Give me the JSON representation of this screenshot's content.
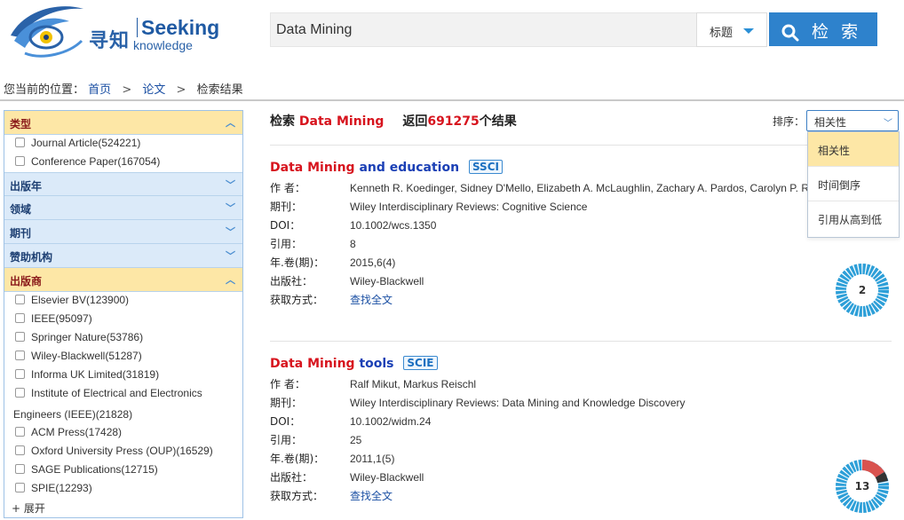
{
  "logo": {
    "cn": "寻知",
    "en": "Seeking",
    "sub": "knowledge"
  },
  "search": {
    "value": "Data Mining",
    "field": "标题",
    "button": "检 索"
  },
  "breadcrumb": {
    "prefix": "您当前的位置：",
    "home": "首页",
    "sep1": ">",
    "section": "论文",
    "sep2": ">",
    "current": "检索结果"
  },
  "sidebar": {
    "type": {
      "label": "类型",
      "items": [
        "Journal Article(524221)",
        "Conference Paper(167054)"
      ]
    },
    "year": {
      "label": "出版年"
    },
    "field": {
      "label": "领域"
    },
    "journal": {
      "label": "期刊"
    },
    "funder": {
      "label": "赞助机构"
    },
    "publisher": {
      "label": "出版商",
      "items": [
        "Elsevier BV(123900)",
        "IEEE(95097)",
        "Springer Nature(53786)",
        "Wiley-Blackwell(51287)",
        "Informa UK Limited(31819)",
        "Institute of Electrical and Electronics"
      ],
      "wrap": "Engineers (IEEE)(21828)",
      "items2": [
        "ACM Press(17428)",
        "Oxford University Press (OUP)(16529)",
        "SAGE Publications(12715)",
        "SPIE(12293)"
      ],
      "expand": "+ 展开"
    }
  },
  "results_header": {
    "prefix": "检索",
    "query": "Data Mining",
    "returned": "返回",
    "count": "691275",
    "suffix": "个结果"
  },
  "sort": {
    "label": "排序：",
    "selected": "相关性",
    "options": [
      "相关性",
      "时间倒序",
      "引用从高到低"
    ]
  },
  "labels": {
    "author": "作 者：",
    "journal": "期刊：",
    "doi": "DOI：",
    "cite": "引用：",
    "year": "年.卷(期)：",
    "publisher": "出版社：",
    "access": "获取方式："
  },
  "results": [
    {
      "title_hl": "Data Mining",
      "title_rest": " and education",
      "badge": "SSCI",
      "author": "Kenneth R. Koedinger, Sidney D'Mello, Elizabeth A. McLaughlin, Zachary A. Pardos, Carolyn P. R",
      "journal": "Wiley Interdisciplinary Reviews: Cognitive Science",
      "doi": "10.1002/wcs.1350",
      "cite": "8",
      "year": "2015,6(4)",
      "publisher": "Wiley-Blackwell",
      "access": "查找全文",
      "altmetric": "2"
    },
    {
      "title_hl": "Data Mining",
      "title_rest": " tools",
      "badge": "SCIE",
      "author": "Ralf Mikut, Markus Reischl",
      "journal": "Wiley Interdisciplinary Reviews: Data Mining and Knowledge Discovery",
      "doi": "10.1002/widm.24",
      "cite": "25",
      "year": "2011,1(5)",
      "publisher": "Wiley-Blackwell",
      "access": "查找全文",
      "altmetric": "13"
    }
  ],
  "colors": {
    "accent": "#2e82cc",
    "highlight": "#d7141e",
    "facet_open": "#fde7a6",
    "facet_closed": "#dbeaf9"
  }
}
